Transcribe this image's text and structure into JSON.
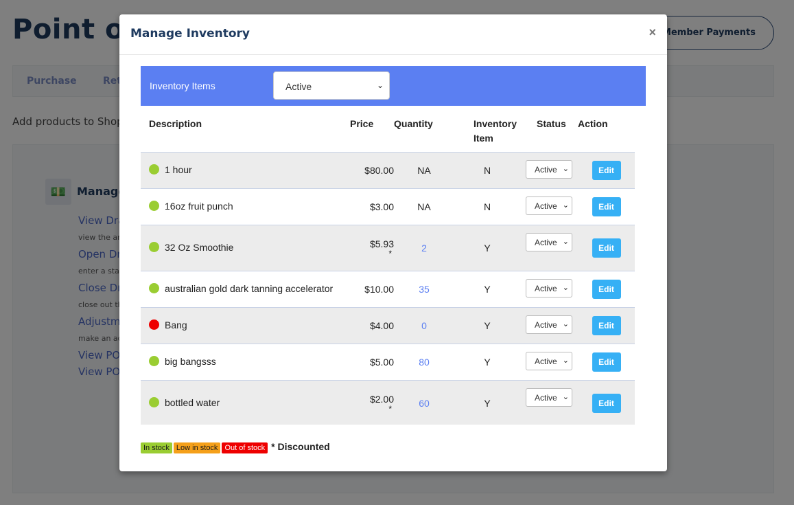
{
  "background": {
    "title": "Point of Sale",
    "member_payments_button": "Member Payments",
    "tabs": [
      "Purchase",
      "Returns"
    ],
    "hint": "Add products to Shopping Cart",
    "panel": {
      "icon": "money-icon",
      "title": "Manage Drawer",
      "links": [
        {
          "label": "View Drawer",
          "desc": "view the amount in drawer"
        },
        {
          "label": "Open Drawer",
          "desc": "enter a starting amount"
        },
        {
          "label": "Close Drawer",
          "desc": "close out the drawer"
        },
        {
          "label": "Adjustments",
          "desc": "make an adjustment"
        },
        {
          "label": "View POS",
          "desc": ""
        },
        {
          "label": "View POS",
          "desc": ""
        }
      ]
    }
  },
  "modal": {
    "title": "Manage Inventory",
    "close_label": "×",
    "filter_label": "Inventory Items",
    "filter_value": "Active",
    "columns": {
      "description": "Description",
      "price": "Price",
      "quantity": "Quantity",
      "inventory_item_1": "Inventory",
      "inventory_item_2": "Item",
      "status": "Status",
      "action": "Action"
    },
    "items": [
      {
        "description": "1 hour",
        "price": "$80.00",
        "discounted": "",
        "quantity": "NA",
        "inventory_item": "N",
        "status": "Active",
        "action": "Edit",
        "stock_color": "#9acd32"
      },
      {
        "description": "16oz fruit punch",
        "price": "$3.00",
        "discounted": "",
        "quantity": "NA",
        "inventory_item": "N",
        "status": "Active",
        "action": "Edit",
        "stock_color": "#9acd32"
      },
      {
        "description": "32 Oz Smoothie",
        "price": "$5.93",
        "discounted": "*",
        "quantity": "2",
        "inventory_item": "Y",
        "status": "Active",
        "action": "Edit",
        "stock_color": "#9acd32"
      },
      {
        "description": "australian gold dark tanning accelerator",
        "price": "$10.00",
        "discounted": "",
        "quantity": "35",
        "inventory_item": "Y",
        "status": "Active",
        "action": "Edit",
        "stock_color": "#9acd32"
      },
      {
        "description": "Bang",
        "price": "$4.00",
        "discounted": "",
        "quantity": "0",
        "inventory_item": "Y",
        "status": "Active",
        "action": "Edit",
        "stock_color": "#ee0000"
      },
      {
        "description": "big bangsss",
        "price": "$5.00",
        "discounted": "",
        "quantity": "80",
        "inventory_item": "Y",
        "status": "Active",
        "action": "Edit",
        "stock_color": "#9acd32"
      },
      {
        "description": "bottled water",
        "price": "$2.00",
        "discounted": "*",
        "quantity": "60",
        "inventory_item": "Y",
        "status": "Active",
        "action": "Edit",
        "stock_color": "#9acd32"
      }
    ],
    "legend": {
      "in_stock": "In stock",
      "low_in_stock": "Low in stock",
      "out_of_stock": "Out of stock",
      "discounted": "* Discounted",
      "colors": {
        "in_stock": "#9acd32",
        "low_in_stock": "#f5a01a",
        "out_of_stock": "#ee0000"
      }
    },
    "colors": {
      "header_bar": "#5b7ff2",
      "edit_button": "#36b0f5",
      "quantity_link": "#5b7ff2"
    }
  }
}
